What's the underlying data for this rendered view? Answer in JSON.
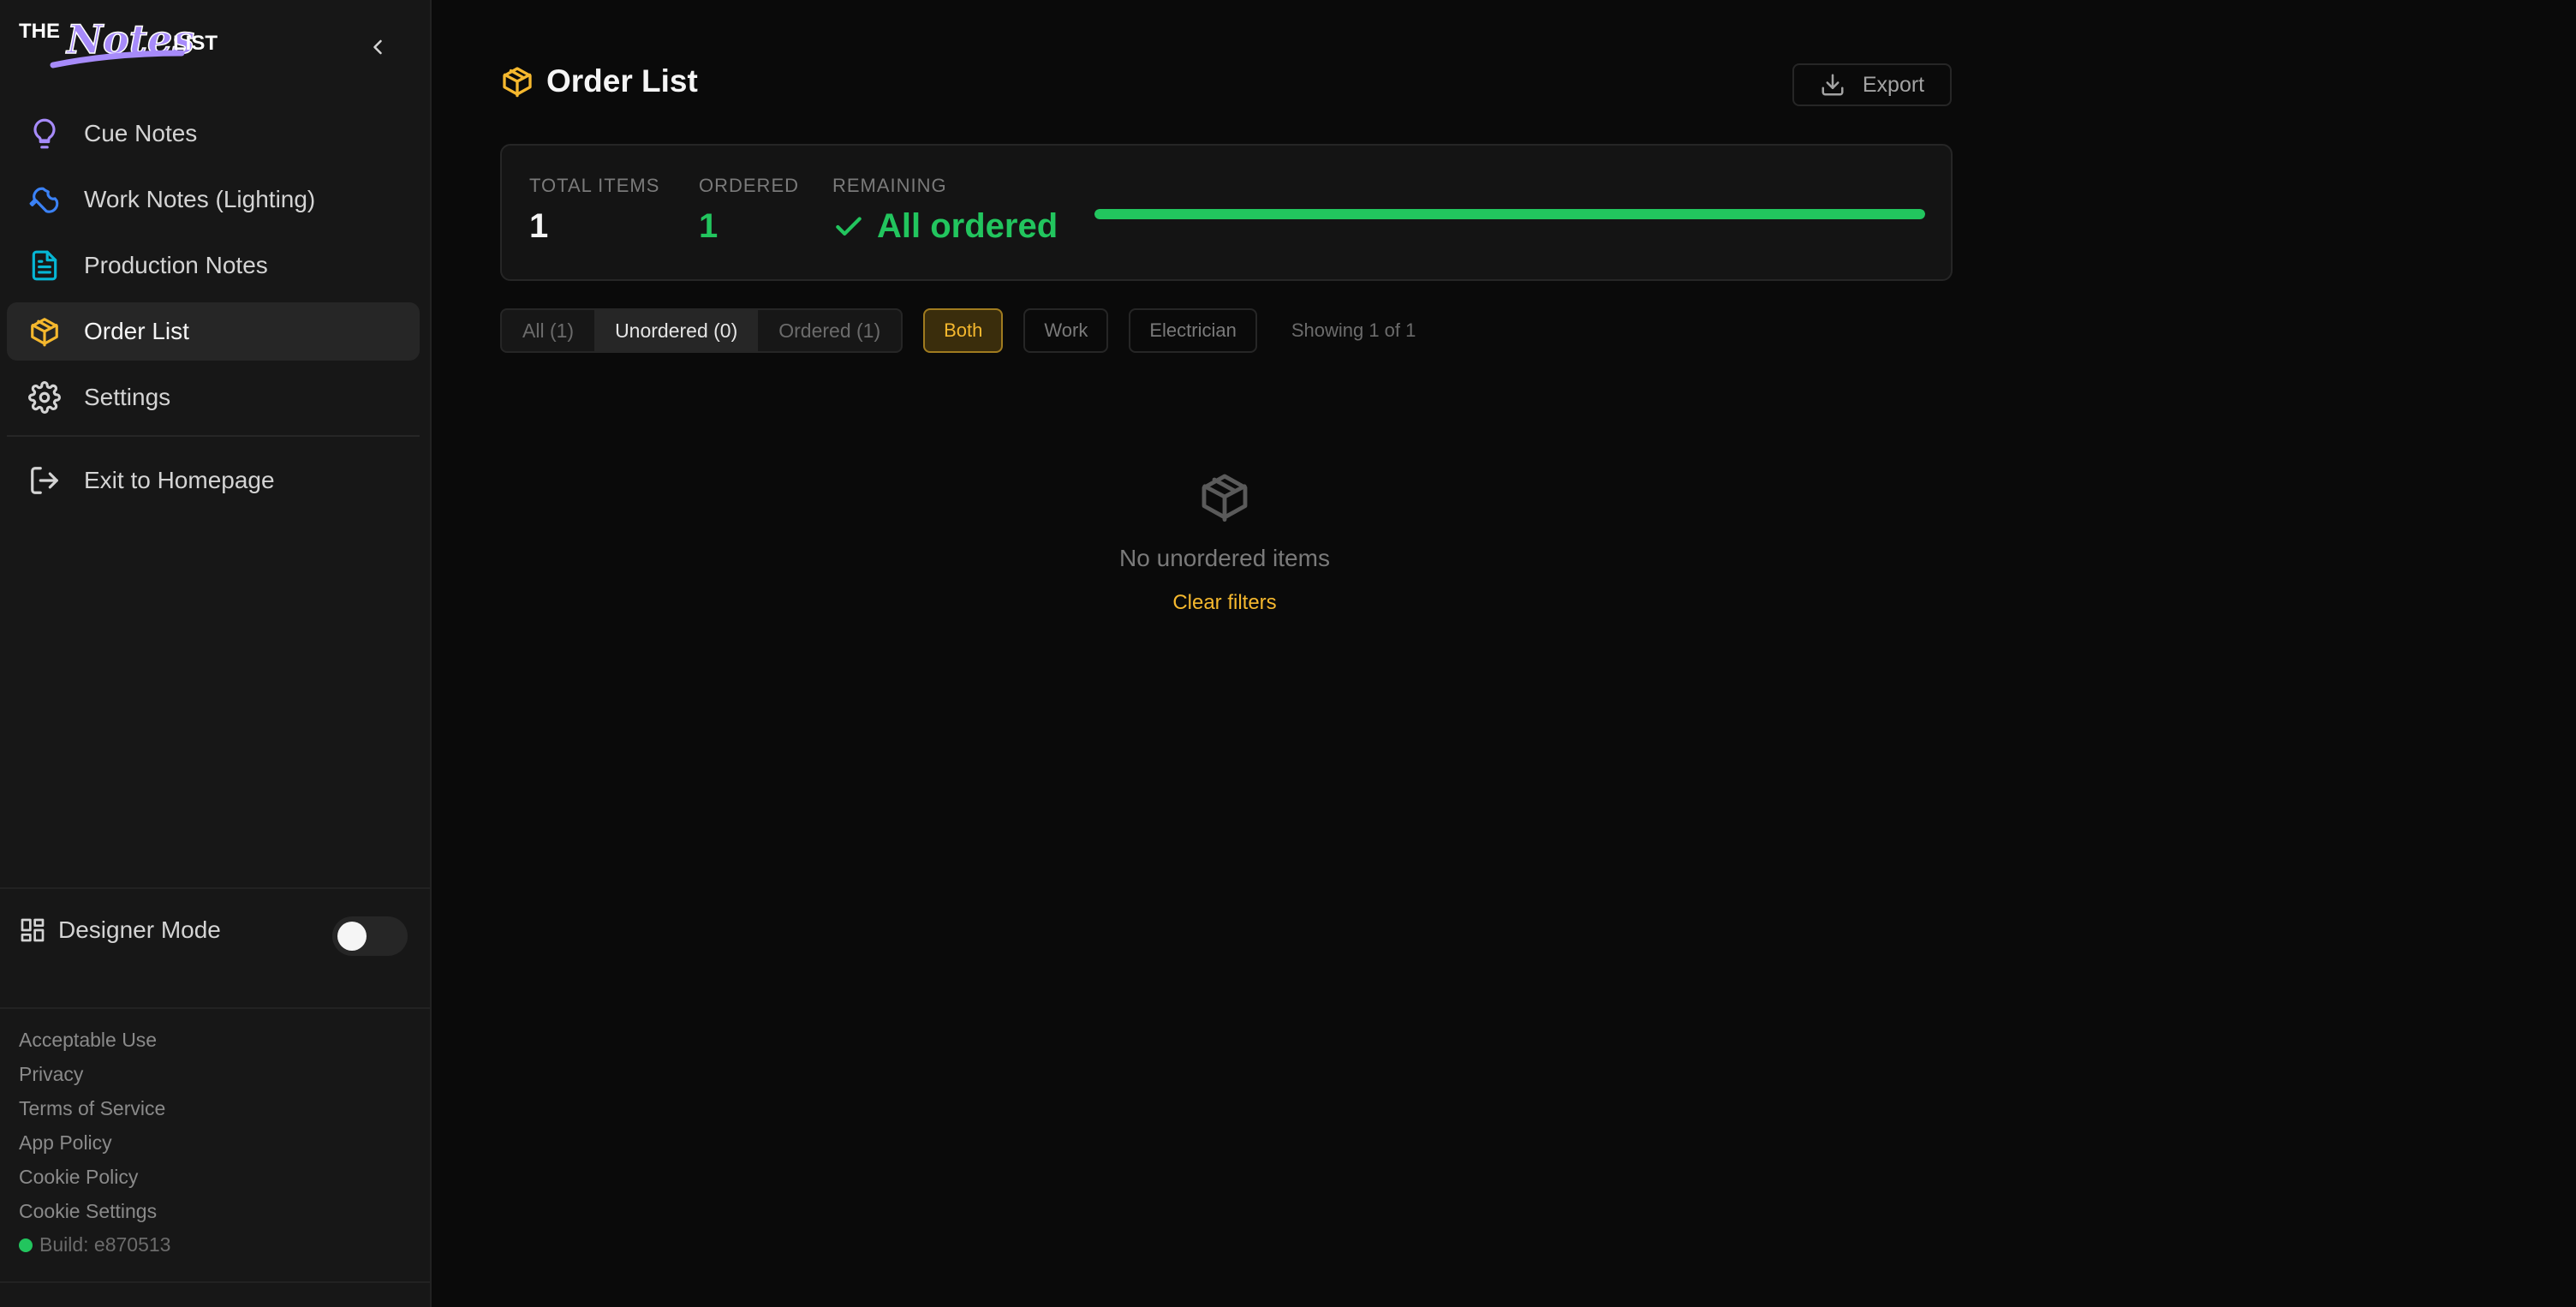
{
  "logo": {
    "the": "THE",
    "notes": "Notes",
    "list": "LIST",
    "brand_color": "#a78bfa"
  },
  "sidebar": {
    "items": [
      {
        "label": "Cue Notes",
        "icon": "lightbulb-icon",
        "color": "#a78bfa"
      },
      {
        "label": "Work Notes (Lighting)",
        "icon": "wrench-icon",
        "color": "#3b82f6"
      },
      {
        "label": "Production Notes",
        "icon": "document-icon",
        "color": "#06b6d4"
      },
      {
        "label": "Order List",
        "icon": "package-icon",
        "color": "#f5b82e",
        "active": true
      },
      {
        "label": "Settings",
        "icon": "gear-icon",
        "color": "#d4d4d4"
      },
      {
        "label": "Exit to Homepage",
        "icon": "exit-icon",
        "color": "#d4d4d4"
      }
    ],
    "designer_mode": {
      "label": "Designer Mode",
      "enabled": false
    },
    "footer_links": [
      "Acceptable Use",
      "Privacy",
      "Terms of Service",
      "App Policy",
      "Cookie Policy",
      "Cookie Settings"
    ],
    "build": "Build: e870513"
  },
  "page": {
    "title": "Order List",
    "export_label": "Export"
  },
  "stats": {
    "total_label": "TOTAL ITEMS",
    "total_value": "1",
    "ordered_label": "ORDERED",
    "ordered_value": "1",
    "remaining_label": "REMAINING",
    "remaining_value": "All ordered",
    "progress": 1.0
  },
  "filters": {
    "status": [
      {
        "label": "All (1)",
        "active": false
      },
      {
        "label": "Unordered (0)",
        "active": true
      },
      {
        "label": "Ordered (1)",
        "active": false
      }
    ],
    "type": [
      {
        "label": "Both",
        "active": true
      },
      {
        "label": "Work",
        "active": false
      },
      {
        "label": "Electrician",
        "active": false
      }
    ],
    "showing": "Showing 1 of 1"
  },
  "empty_state": {
    "message": "No unordered items",
    "clear_label": "Clear filters"
  },
  "colors": {
    "accent": "#f5b82e",
    "success": "#22c55e",
    "background": "#0a0a0a",
    "sidebar": "#171717"
  }
}
